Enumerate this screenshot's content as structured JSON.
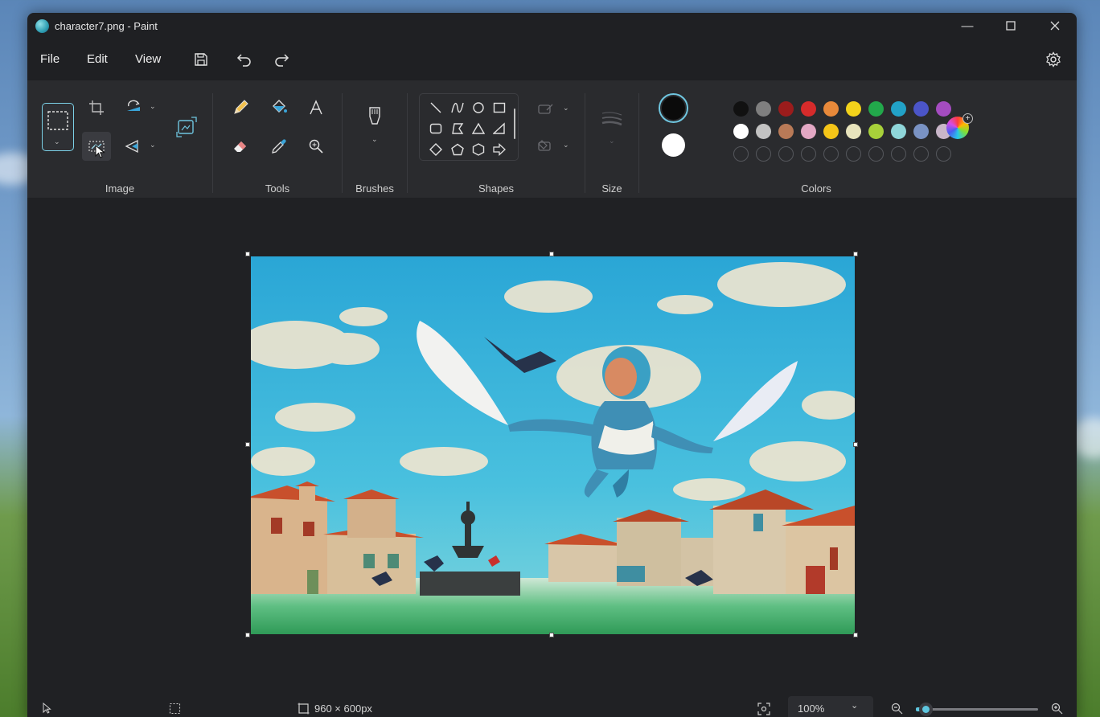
{
  "window": {
    "title": "character7.png - Paint",
    "controls": {
      "minimize": "—",
      "maximize": "☐",
      "close": "✕"
    }
  },
  "menu": {
    "file": "File",
    "edit": "Edit",
    "view": "View"
  },
  "ribbon": {
    "groups": {
      "image": "Image",
      "tools": "Tools",
      "brushes": "Brushes",
      "shapes": "Shapes",
      "size": "Size",
      "colors": "Colors"
    }
  },
  "colors": {
    "primary": "#0b0b0b",
    "secondary": "#ffffff",
    "row1": [
      "#111111",
      "#7f7f7f",
      "#9b1c1c",
      "#d62b2b",
      "#e8893a",
      "#f2d21b",
      "#22a84b",
      "#22a2c7",
      "#4b55c8",
      "#a44cc0"
    ],
    "row2": [
      "#ffffff",
      "#c3c3c3",
      "#b97a57",
      "#e3a8c4",
      "#f5c518",
      "#e8e4bd",
      "#a8d13a",
      "#8fd6d9",
      "#7a93c4",
      "#c9b6c9"
    ],
    "custom_slots": 10,
    "accent": "#5ec6df"
  },
  "status": {
    "canvas_size": "960 × 600px",
    "zoom": "100%",
    "zoom_fraction": 0.08
  }
}
